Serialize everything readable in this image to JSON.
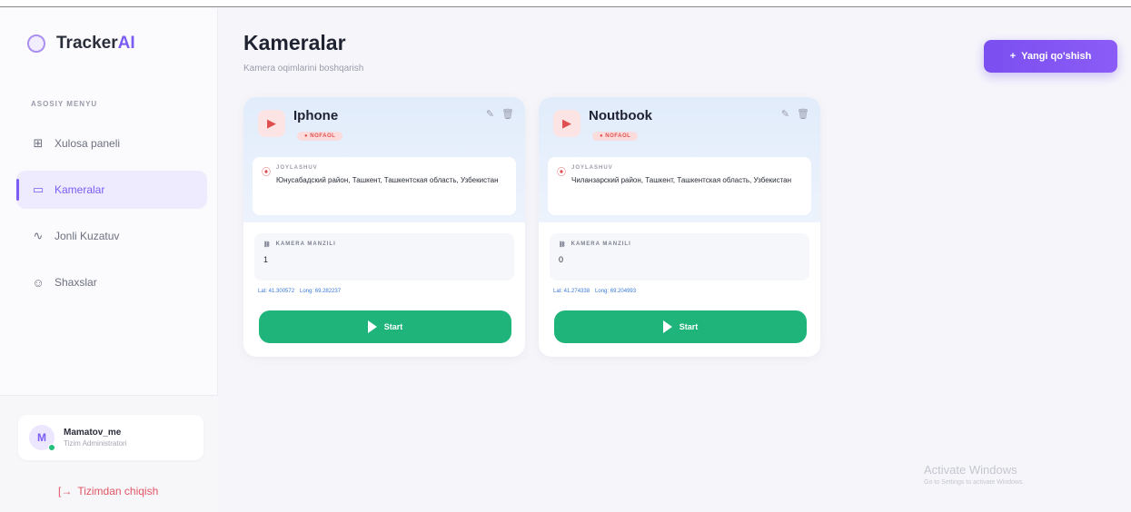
{
  "app": {
    "brand_main": "Tracker",
    "brand_accent": "AI"
  },
  "sidebar": {
    "section_label": "ASOSIY MENYU",
    "items": [
      {
        "label": "Xulosa paneli",
        "icon": "dashboard-icon",
        "active": false
      },
      {
        "label": "Kameralar",
        "icon": "camera-icon",
        "active": true
      },
      {
        "label": "Jonli Kuzatuv",
        "icon": "activity-icon",
        "active": false
      },
      {
        "label": "Shaxslar",
        "icon": "users-icon",
        "active": false
      }
    ],
    "user": {
      "initial": "M",
      "name": "Mamatov_me",
      "role": "Tizim Administratori"
    },
    "logout_label": "Tizimdan chiqish"
  },
  "header": {
    "title": "Kameralar",
    "subtitle": "Kamera oqimlarini boshqarish",
    "add_button_label": "Yangi qo'shish"
  },
  "cameras": [
    {
      "name": "Iphone",
      "status": "NOFAOL",
      "location_label": "JOYLASHUV",
      "location": "Юнусабадский район, Ташкент, Ташкентская область, Узбекистан",
      "address_label": "KAMERA MANZILI",
      "address": "1",
      "lat": "Lat: 41.300572",
      "long": "Long: 69.282237",
      "start_label": "Start"
    },
    {
      "name": "Noutbook",
      "status": "NOFAOL",
      "location_label": "JOYLASHUV",
      "location": "Чиланзарский район, Ташкент, Ташкентская область, Узбекистан",
      "address_label": "KAMERA MANZILI",
      "address": "0",
      "lat": "Lat: 41.274338",
      "long": "Long: 69.204993",
      "start_label": "Start"
    }
  ],
  "watermark": {
    "title": "Activate Windows",
    "subtitle": "Go to Settings to activate Windows."
  },
  "colors": {
    "accent": "#7b5cf5",
    "start": "#1eb47a",
    "inactive": "#e04f4f"
  }
}
